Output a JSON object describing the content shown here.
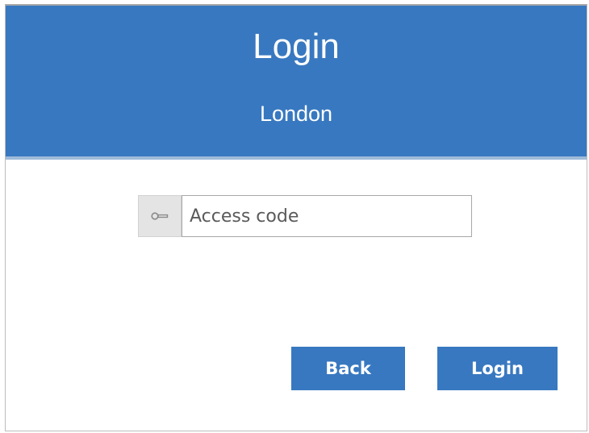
{
  "header": {
    "title": "Login",
    "subtitle": "London"
  },
  "form": {
    "access_code": {
      "icon": "key-icon",
      "value": "",
      "placeholder": "Access code"
    }
  },
  "buttons": {
    "back_label": "Back",
    "login_label": "Login"
  },
  "colors": {
    "primary": "#3878c0",
    "header_border": "#9fbbd9",
    "addon_bg": "#e4e4e4"
  }
}
